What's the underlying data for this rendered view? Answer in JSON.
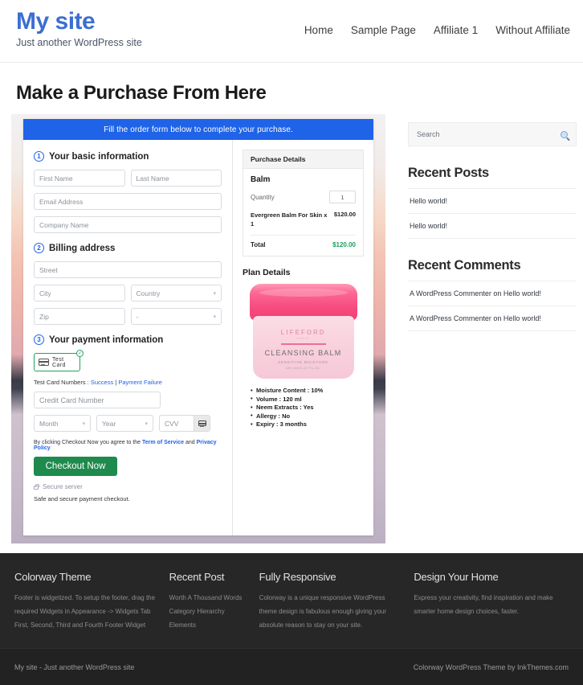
{
  "header": {
    "site_title": "My site",
    "tagline": "Just another WordPress site",
    "nav": [
      {
        "label": "Home"
      },
      {
        "label": "Sample Page"
      },
      {
        "label": "Affiliate 1"
      },
      {
        "label": "Without Affiliate"
      }
    ]
  },
  "page": {
    "title": "Make a Purchase From Here"
  },
  "form": {
    "banner": "Fill the order form below to complete your purchase.",
    "step1": {
      "number": "1",
      "label": "Your basic information",
      "first_name_placeholder": "First Name",
      "last_name_placeholder": "Last Name",
      "email_placeholder": "Email Address",
      "company_placeholder": "Company Name"
    },
    "step2": {
      "number": "2",
      "label": "Billing address",
      "street_placeholder": "Street",
      "city_placeholder": "City",
      "country_placeholder": "Country",
      "zip_placeholder": "Zip",
      "state_placeholder": "-"
    },
    "step3": {
      "number": "3",
      "label": "Your payment information",
      "card_tab_label": "Test  Card",
      "card_tab_selected_icon": "check-circle-icon",
      "test_numbers_label": "Test Card Numbers : ",
      "test_success_link": "Success",
      "test_separator": " | ",
      "test_failure_link": "Payment Failure",
      "card_number_placeholder": "Credit Card Number",
      "month_placeholder": "Month",
      "year_placeholder": "Year",
      "cvv_placeholder": "CVV"
    },
    "terms_prefix": "By clicking Checkout Now you agree to the ",
    "terms_link": "Term of Service",
    "terms_mid": " and ",
    "privacy_link": "Privacy Policy",
    "checkout_label": "Checkout Now",
    "secure_server": "Secure server",
    "safe_note": "Safe and secure payment checkout."
  },
  "purchase_details": {
    "heading": "Purchase Details",
    "product_title": "Balm",
    "quantity_label": "Quantity",
    "quantity_value": "1",
    "line_item_name": "Evergreen Balm For Skin x 1",
    "line_item_price": "$120.00",
    "total_label": "Total",
    "total_value": "$120.00",
    "total_color": "#19a05c"
  },
  "plan_details": {
    "heading": "Plan Details",
    "product_image": {
      "brand": "LIFEFORD",
      "brand_sub": "PARIS",
      "name": "CLEANSING BALM",
      "sub1": "SENSITIVE MOISTURE",
      "sub2": "120 mle/4.22 FL.OZ.",
      "lid_color": "#f74c7f",
      "body_color": "#f9d2de"
    },
    "features": [
      "Moisture Content : 10%",
      "Volume : 120 ml",
      "Neem Extracts : Yes",
      "Allergy : No",
      "Expiry : 3 months"
    ]
  },
  "sidebar": {
    "search_placeholder": "Search",
    "search_icon": "magnifier-icon",
    "widgets": [
      {
        "title": "Recent Posts",
        "items": [
          "Hello world!",
          "Hello world!"
        ]
      },
      {
        "title": "Recent Comments",
        "items": [
          "A WordPress Commenter on Hello world!",
          "A WordPress Commenter on Hello world!"
        ]
      }
    ]
  },
  "footer": {
    "columns": [
      {
        "title": "Colorway Theme",
        "lines": [
          "Footer is widgetized. To setup the footer, drag the",
          "required Widgets in Appearance -> Widgets Tab",
          "First, Second, Third and Fourth Footer Widget"
        ]
      },
      {
        "title": "Recent Post",
        "lines": [
          "Worth A Thousand Words",
          "Category Hierarchy",
          "Elements"
        ]
      },
      {
        "title": "Fully Responsive",
        "lines": [
          "Colorway is a unique responsive WordPress",
          "theme design is fabulous enough giving your",
          "absolute reason to stay on your site."
        ]
      },
      {
        "title": "Design Your Home",
        "lines": [
          "Express your creativity, find inspiration and make",
          "smarter home design choices, faster."
        ]
      }
    ],
    "copyright_left": "My site - Just another WordPress site",
    "copyright_right": "Colorway WordPress Theme by InkThemes.com"
  },
  "colors": {
    "brand_blue": "#3c6fd1",
    "banner_blue": "#1f63e8",
    "checkout_green": "#1f8a4d",
    "footer_bg": "#272727"
  }
}
